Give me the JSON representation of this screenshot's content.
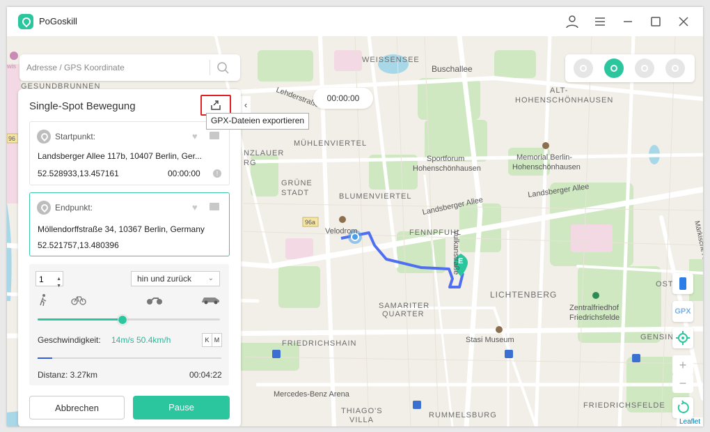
{
  "app": {
    "title": "PoGoskill"
  },
  "search": {
    "placeholder": "Adresse / GPS Koordinate"
  },
  "panel": {
    "title": "Single-Spot Bewegung",
    "export_tooltip": "GPX-Dateien exportieren",
    "start": {
      "caption": "Startpunkt:",
      "address": "Landsberger Allee 117b, 10407 Berlin, Ger...",
      "coords": "52.528933,13.457161",
      "time": "00:00:00",
      "warn": "!"
    },
    "end": {
      "caption": "Endpunkt:",
      "address": "Möllendorffstraße 34, 10367 Berlin, Germany",
      "coords": "52.521757,13.480396"
    },
    "count": "1",
    "mode": "hin und zurück",
    "speed_label": "Geschwindigkeit:",
    "speed_value": "14m/s 50.4km/h",
    "unit_k": "K",
    "unit_m": "M",
    "speed_level_percent": 46,
    "progress_percent": 8,
    "distance": "Distanz: 3.27km",
    "remaining": "00:04:22",
    "cancel": "Abbrechen",
    "pause": "Pause"
  },
  "timer": "00:00:00",
  "right_tools": {
    "gpx": "GPX",
    "zoom_in": "+",
    "zoom_out": "−"
  },
  "attribution": "Leaflet",
  "map_labels": {
    "weissensee": "WEISSENSEE",
    "buschallee": "Buschallee",
    "gesundbrunnen": "GESUNDBRUNNEN",
    "lehderstrasse": "Lehderstraße",
    "alt": "ALT-",
    "hohenschoenhausen": "HOHENSCHÖNHAUSEN",
    "muehlenviertel": "MÜHLENVIERTEL",
    "sportforum1": "Sportforum",
    "sportforum2": "Hohenschönhausen",
    "memorial1": "Memorial Berlin-",
    "memorial2": "Hohenschönhausen",
    "nzlauer": "NZLAUER",
    "rg": "RG",
    "gruene": "GRÜNE",
    "stadt": "STADT",
    "blumenviertel": "BLUMENVIERTEL",
    "landsberger1": "Landsberger Allee",
    "landsberger2": "Landsberger Allee",
    "velodrom": "Velodrom",
    "fennpfuhl": "FENNPFUHL",
    "vulkanstrasse": "Vulkanstraße",
    "lichtenberg": "LICHTENBERG",
    "samariter": "SAMARITER",
    "quarter": "QUARTER",
    "zentralfriedhof1": "Zentralfriedhof",
    "zentralfriedhof2": "Friedrichsfelde",
    "stasi": "Stasi Museum",
    "friedrichshain": "FRIEDRICHSHAIN",
    "mercedes": "Mercedes-Benz Arena",
    "thiagos1": "THIAGO'S",
    "thiagos2": "VILLA",
    "rummelsburg": "RUMMELSBURG",
    "friedrichsfelde": "FRIEDRICHSFELDE",
    "gensin": "GENSIN",
    "os": "OST",
    "maerkische": "Märkische Allee",
    "badge96a": "96a",
    "badge96": "96",
    "wis": "wis",
    "endmarker": "E"
  }
}
